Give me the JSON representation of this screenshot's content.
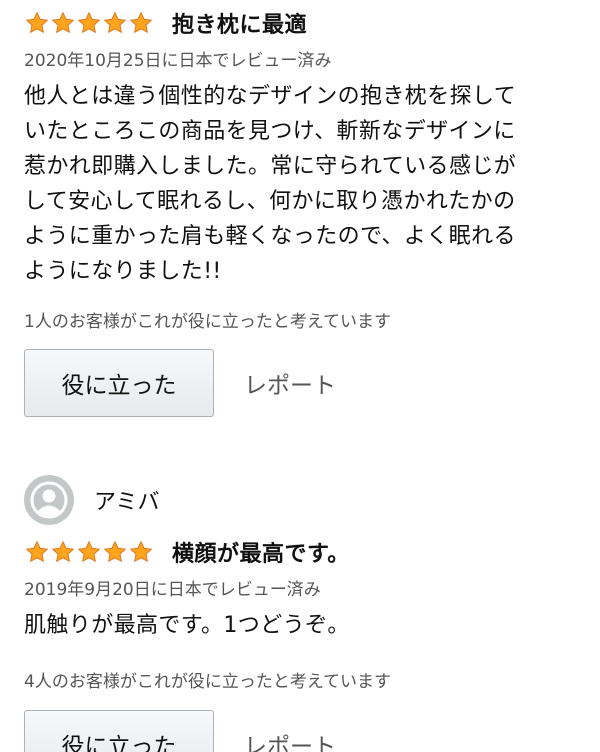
{
  "reviews": [
    {
      "rating": 5,
      "title": "抱き枕に最適",
      "meta": "2020年10月25日に日本でレビュー済み",
      "body_lines": [
        "他人とは違う個性的なデザインの抱き枕を探して",
        "いたところこの商品を見つけ、斬新なデザインに",
        "惹かれ即購入しました。常に守られている感じが",
        "して安心して眠れるし、何かに取り憑かれたかの",
        "ように重かった肩も軽くなったので、よく眠れる",
        "ようになりました!!"
      ],
      "helpful_text": "1人のお客様がこれが役に立ったと考えています",
      "helpful_button": "役に立った",
      "report_link": "レポート"
    },
    {
      "reviewer": "アミバ",
      "rating": 5,
      "title": "横顔が最高です。",
      "meta": "2019年9月20日に日本でレビュー済み",
      "body_lines": [
        "肌触りが最高です。1つどうぞ。"
      ],
      "helpful_text": "4人のお客様がこれが役に立ったと考えています",
      "helpful_button": "役に立った",
      "report_link": "レポート"
    }
  ],
  "colors": {
    "star_fill": "#ffa41c",
    "star_stroke": "#de7921",
    "muted_text": "#555555",
    "avatar_bg": "#c4c7c8"
  },
  "icons": {
    "star": "star-icon",
    "avatar": "avatar-icon"
  }
}
